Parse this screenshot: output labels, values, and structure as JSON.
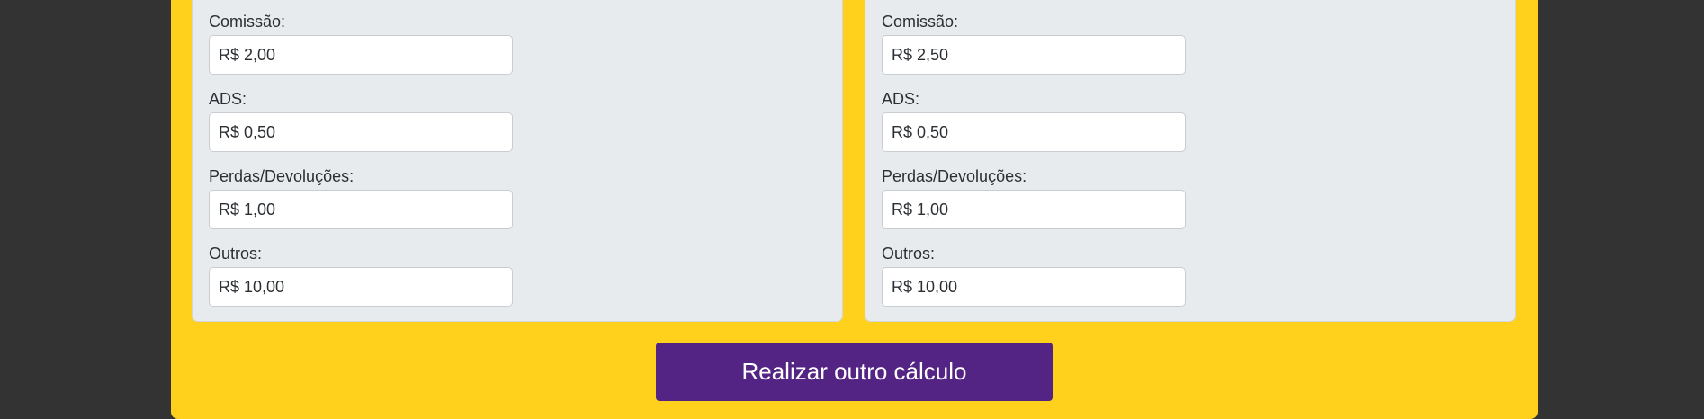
{
  "cards": [
    {
      "fields": [
        {
          "label": "Comissão:",
          "value": "R$ 2,00"
        },
        {
          "label": "ADS:",
          "value": "R$ 0,50"
        },
        {
          "label": "Perdas/Devoluções:",
          "value": "R$ 1,00"
        },
        {
          "label": "Outros:",
          "value": "R$ 10,00"
        }
      ]
    },
    {
      "fields": [
        {
          "label": "Comissão:",
          "value": "R$ 2,50"
        },
        {
          "label": "ADS:",
          "value": "R$ 0,50"
        },
        {
          "label": "Perdas/Devoluções:",
          "value": "R$ 1,00"
        },
        {
          "label": "Outros:",
          "value": "R$ 10,00"
        }
      ]
    }
  ],
  "action_button": {
    "label": "Realizar outro cálculo"
  },
  "colors": {
    "background": "#333333",
    "panel": "#ffd11d",
    "card": "#e8ebee",
    "button": "#542484"
  }
}
